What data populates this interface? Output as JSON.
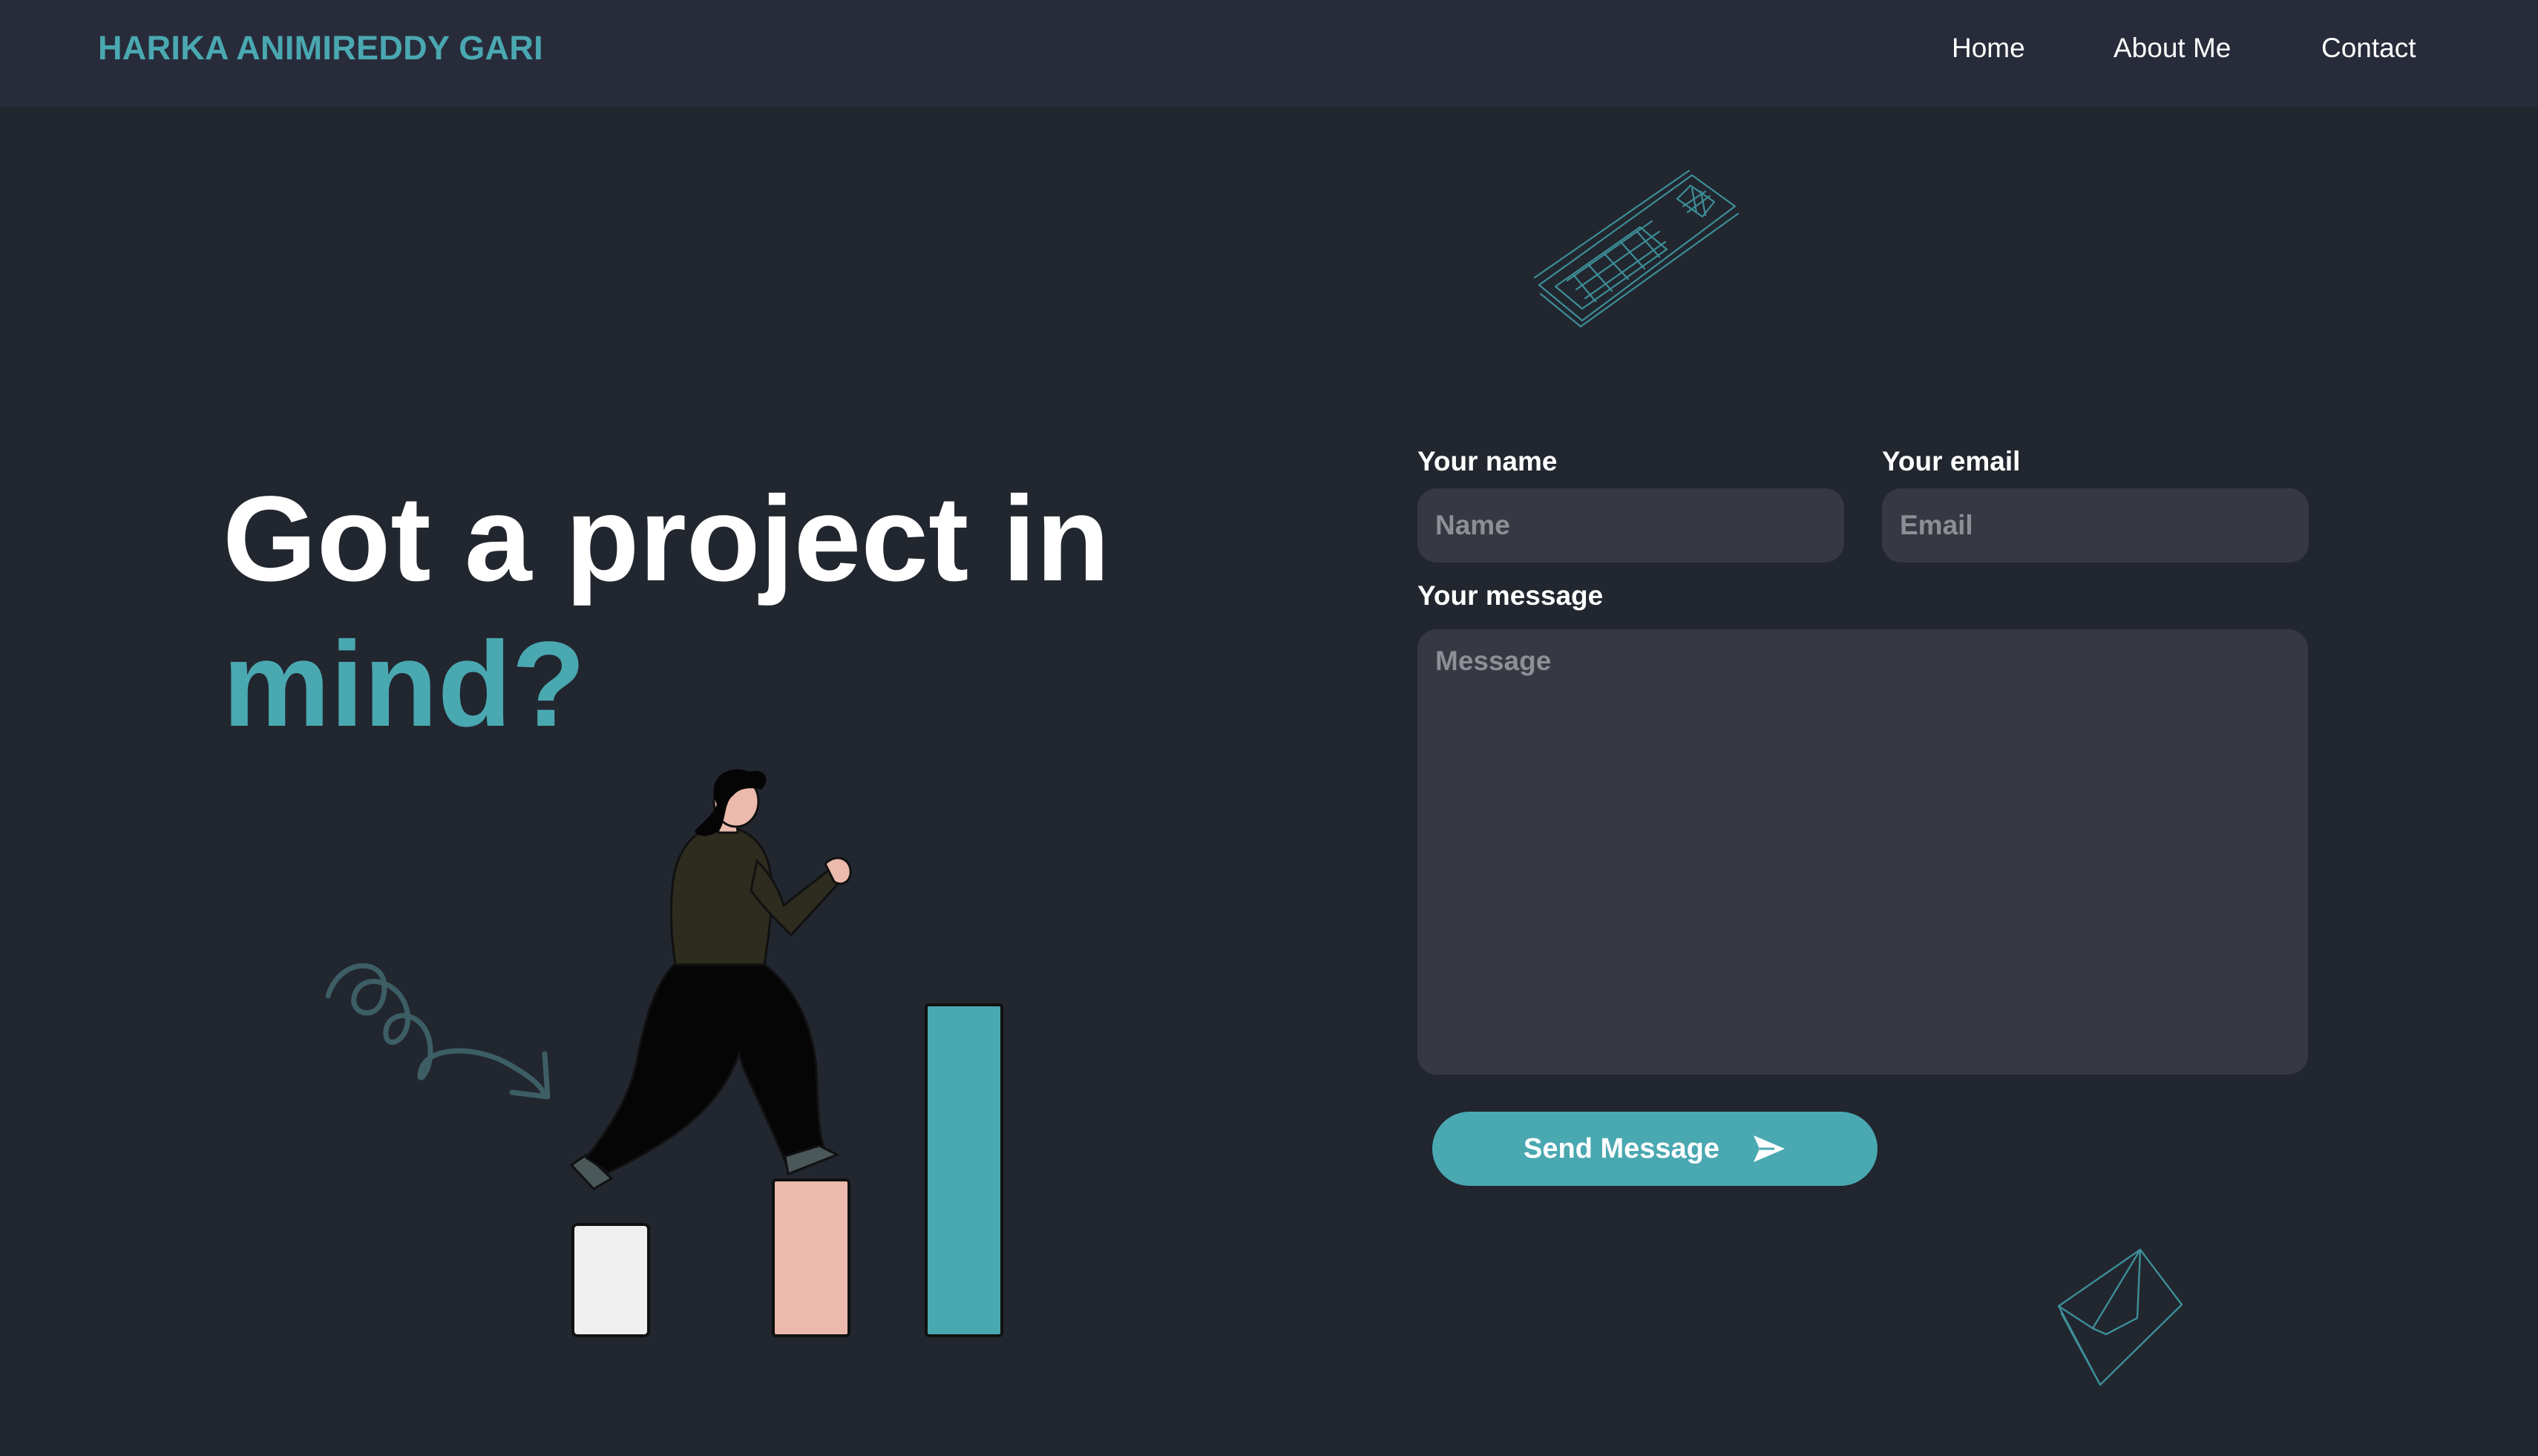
{
  "navbar": {
    "brand": "HARIKA ANIMIREDDY GARI",
    "links": [
      "Home",
      "About Me",
      "Contact"
    ]
  },
  "hero": {
    "line1": "Got a project in",
    "line2": "mind?"
  },
  "form": {
    "name_label": "Your name",
    "name_placeholder": "Name",
    "email_label": "Your email",
    "email_placeholder": "Email",
    "message_label": "Your message",
    "message_placeholder": "Message",
    "submit_label": "Send Message"
  },
  "icons": {
    "submit": "send-plane-icon"
  },
  "colors": {
    "background": "#22262f",
    "navbar": "#282c3a",
    "accent": "#4aa8b1",
    "field": "#363942",
    "bar_white": "#efefef",
    "bar_pink": "#ebbaad",
    "bar_teal": "#4aa8b1"
  }
}
